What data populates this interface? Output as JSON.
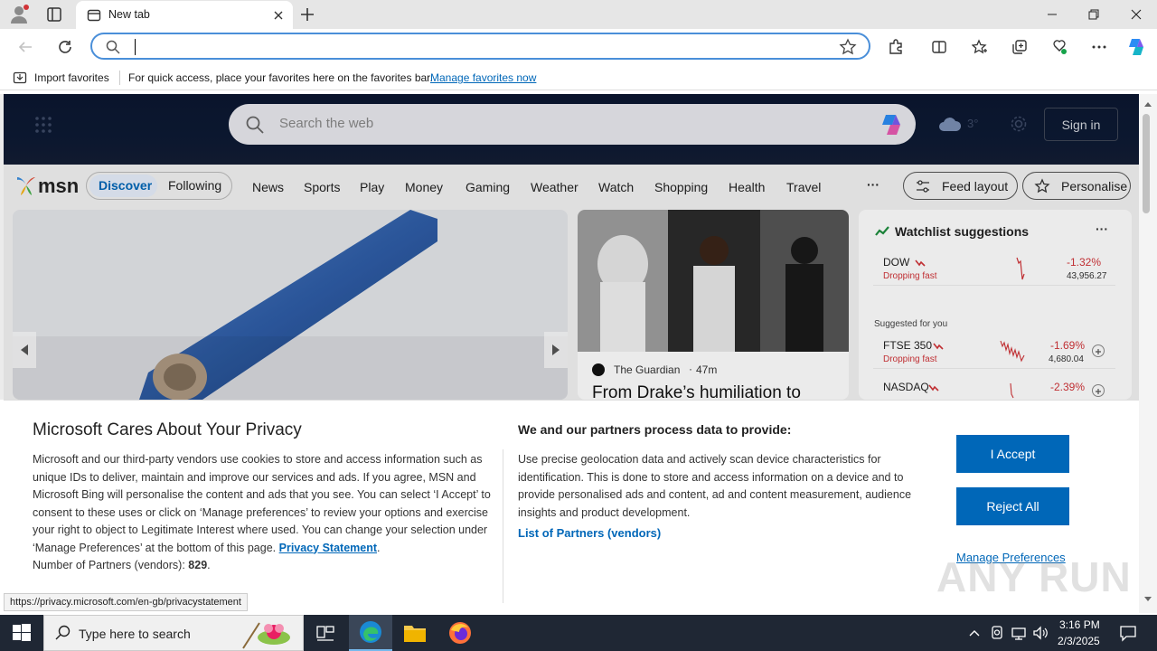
{
  "browser": {
    "tab_title": "New tab",
    "address_value": "",
    "favbar": {
      "import_label": "Import favorites",
      "hint": "For quick access, place your favorites here on the favorites bar.",
      "manage_link": "Manage favorites now"
    }
  },
  "msn": {
    "search_placeholder": "Search the web",
    "weather_temp": "3°",
    "signin_label": "Sign in",
    "logo_text": "msn",
    "tabs": [
      "Discover",
      "Following"
    ],
    "nav_items": [
      "News",
      "Sports",
      "Play",
      "Money",
      "Gaming",
      "Weather",
      "Watch",
      "Shopping",
      "Health",
      "Travel"
    ],
    "more_label": "···",
    "feed_layout_label": "Feed layout",
    "personalise_label": "Personalise",
    "story": {
      "source": "The Guardian",
      "time": "47m",
      "headline": "From Drake’s humiliation to"
    },
    "watchlist": {
      "title": "Watchlist suggestions",
      "more": "···",
      "suggested_label": "Suggested for you",
      "stocks": [
        {
          "name": "DOW",
          "status": "Dropping fast",
          "change": "-1.32%",
          "price": "43,956.27"
        },
        {
          "name": "FTSE 350",
          "status": "Dropping fast",
          "change": "-1.69%",
          "price": "4,680.04"
        },
        {
          "name": "NASDAQ",
          "status": "",
          "change": "-2.39%",
          "price": ""
        }
      ]
    }
  },
  "privacy": {
    "title": "Microsoft Cares About Your Privacy",
    "body": "Microsoft and our third-party vendors use cookies to store and access information such as unique IDs to deliver, maintain and improve our services and ads. If you agree, MSN and Microsoft Bing will personalise the content and ads that you see. You can select ‘I Accept’ to consent to these uses or click on ‘Manage preferences’ to review your options and exercise your right to object to Legitimate Interest where used.  You can change your selection under ‘Manage Preferences’ at the bottom of this page.",
    "privacy_link": "Privacy Statement",
    "partners_prefix": "Number of Partners (vendors):",
    "partners_count": "829",
    "right_title": "We and our partners process data to provide:",
    "right_body": "Use precise geolocation data and actively scan device characteristics for identification. This is done to store and access information on a device and to provide personalised ads and content, ad and content measurement, audience insights and product development.",
    "partners_link": "List of Partners (vendors)",
    "accept_label": "I Accept",
    "reject_label": "Reject All",
    "manage_label": "Manage Preferences"
  },
  "status_url": "https://privacy.microsoft.com/en-gb/privacystatement",
  "watermark": "ANY RUN",
  "taskbar": {
    "search_placeholder": "Type here to search",
    "time": "3:16 PM",
    "date": "2/3/2025"
  },
  "colors": {
    "accent": "#0067b8",
    "negative": "#d13438",
    "link": "#0067b8"
  }
}
